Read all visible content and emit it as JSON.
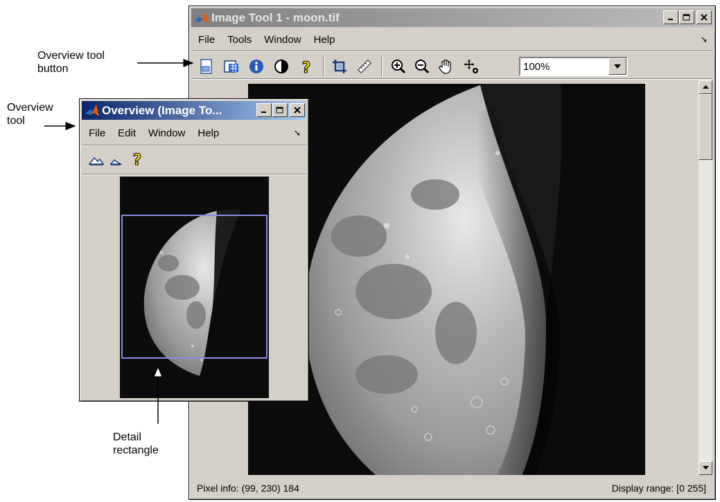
{
  "annotations": {
    "overview_button_line1": "Overview tool",
    "overview_button_line2": "button",
    "overview_tool_line1": "Overview",
    "overview_tool_line2": "tool",
    "detail_rect_line1": "Detail",
    "detail_rect_line2": "rectangle"
  },
  "image_tool": {
    "title": "Image Tool 1 - moon.tif",
    "menus": [
      "File",
      "Tools",
      "Window",
      "Help"
    ],
    "toolbar_icons": [
      "overview-icon",
      "pixel-region-icon",
      "image-info-icon",
      "contrast-icon",
      "help-icon",
      "crop-icon",
      "distance-tool-icon",
      "zoom-in-icon",
      "zoom-out-icon",
      "pan-icon",
      "pixel-info-icon"
    ],
    "zoom": "100%",
    "status": {
      "pixel_info": "Pixel info: (99, 230)  184",
      "display_range": "Display range: [0 255]"
    }
  },
  "overview": {
    "title": "Overview (Image To...",
    "menus": [
      "File",
      "Edit",
      "Window",
      "Help"
    ],
    "toolbar_icons": [
      "zoom-in-overview-icon",
      "zoom-out-overview-icon",
      "help-icon"
    ]
  },
  "colors": {
    "window_face": "#d4d0c8",
    "active_title": "#0a246a",
    "inactive_title": "#808080",
    "detail_rectangle": "#8a8ae8",
    "image_background": "#0c0c0c"
  }
}
